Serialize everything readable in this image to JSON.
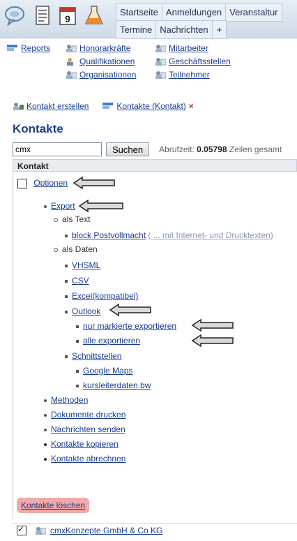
{
  "topbar": {
    "tabs_row1": [
      "Startseite",
      "Anmeldungen",
      "Veranstaltur"
    ],
    "tabs_row2": [
      "Termine",
      "Nachrichten",
      "+"
    ]
  },
  "subnav": {
    "reports": "Reports",
    "honorarkraefte": "Honorarkräfte",
    "mitarbeiter": "Mitarbeiter",
    "qualifikationen": "Qualifikationen",
    "geschaeftsstellen": "Geschäftsstellen",
    "organisationen": "Organisationen",
    "teilnehmer": "Teilnehmer"
  },
  "actions": {
    "create": "Kontakt erstellen",
    "tab": "Kontakte (Kontakt)",
    "close": "×"
  },
  "page_title": "Kontakte",
  "search": {
    "value": "cmx",
    "button": "Suchen",
    "meta_label": "Abrufzeit:",
    "meta_value": "0.05798",
    "meta_rest": "Zeilen gesamt"
  },
  "list_header": "Kontakt",
  "optionen": "Optionen",
  "menu": {
    "export": "Export",
    "als_text": "als Text",
    "block_postvollmacht": "block Postvollmacht",
    "mit_texten": "( ... mit Internet- und Drucktexten)",
    "als_daten": "als Daten",
    "vhsml": "VHSML",
    "csv": "CSV",
    "excel": "Excel(kompatibel)",
    "outlook": "Outlook",
    "nur_markierte": "nur markierte exportieren",
    "alle": "alle exportieren",
    "schnittstellen": "Schnittstellen",
    "google_maps": "Google Maps",
    "kursleiterdaten": "kursleiterdaten.bw",
    "methoden": "Methoden",
    "dokumente": "Dokumente drucken",
    "nachrichten": "Nachrichten senden",
    "kopieren": "Kontakte kopieren",
    "abrechnen": "Kontakte abrechnen"
  },
  "delete_button": "Kontakte löschen",
  "row": {
    "name": "cmxKonzepte GmbH & Co KG",
    "checked": true
  }
}
